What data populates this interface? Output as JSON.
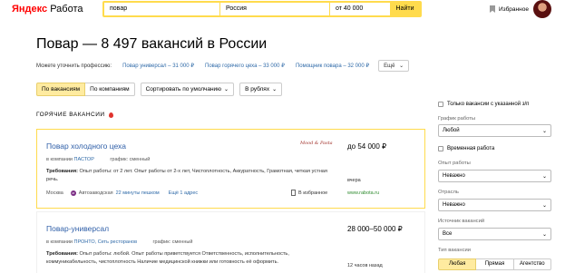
{
  "header": {
    "logo_yandex": "Яндекс",
    "logo_service": "Работа",
    "search_query": "повар",
    "region": "Россия",
    "salary_from": "от 40 000",
    "search_button": "Найти",
    "favorites": "Избранное"
  },
  "page": {
    "title": "Повар — 8 497 вакансий в России",
    "clarify_label": "Можете уточнить профессию:",
    "professions": [
      "Повар универсал – 31 000 ₽",
      "Повар горячего цеха – 33 000 ₽",
      "Помощник повара – 32 000 ₽"
    ],
    "more_button": "Ещё"
  },
  "controls": {
    "by_vacancies": "По вакансиям",
    "by_companies": "По компаниям",
    "sort": "Сортировать по умолчанию",
    "currency": "В рублях"
  },
  "hot_label": "ГОРЯЧИЕ ВАКАНСИИ",
  "vacancies": [
    {
      "title": "Повар холодного цеха",
      "company_prefix": "в компании",
      "company": "ПАСТОР",
      "schedule": "график: сменный",
      "company_logo": "Mood & Pasta",
      "requirements_label": "Требования:",
      "requirements": "Опыт работы: от 2 лет. Опыт работы от 2-х лет, Чистоплотность, Аккуратность, Грамотная, четкая устная речь.",
      "salary": "до 54 000 ₽",
      "when": "вчера",
      "site": "www.rabota.ru",
      "city": "Москва",
      "metro_station": "Автозаводская",
      "walk": "22 минуты пешком",
      "address": "Ещё 1 адрес",
      "favorite": "В избранное"
    },
    {
      "title": "Повар-универсал",
      "company_prefix": "в компании",
      "company": "ПРОНТО, Сеть ресторанов",
      "schedule": "график: сменный",
      "requirements_label": "Требования:",
      "requirements": "Опыт работы: любой. Опыт работы приветствуется Ответственность, исполнительность, коммуникабельность, чистоплотность Наличие медицинской книжки или готовность её оформить.",
      "salary": "28 000–50 000 ₽",
      "when": "12 часов назад"
    }
  ],
  "filters": {
    "salary_only": "Только вакансии с указанной з/п",
    "schedule_label": "График работы",
    "schedule_value": "Любой",
    "temporary": "Временная работа",
    "experience_label": "Опыт работы",
    "experience_value": "Неважно",
    "industry_label": "Отрасль",
    "industry_value": "Неважно",
    "source_label": "Источник вакансий",
    "source_value": "Все",
    "employer_label": "Тип вакансии",
    "employer_options": [
      "Любая",
      "Прямая",
      "Агентство"
    ]
  }
}
